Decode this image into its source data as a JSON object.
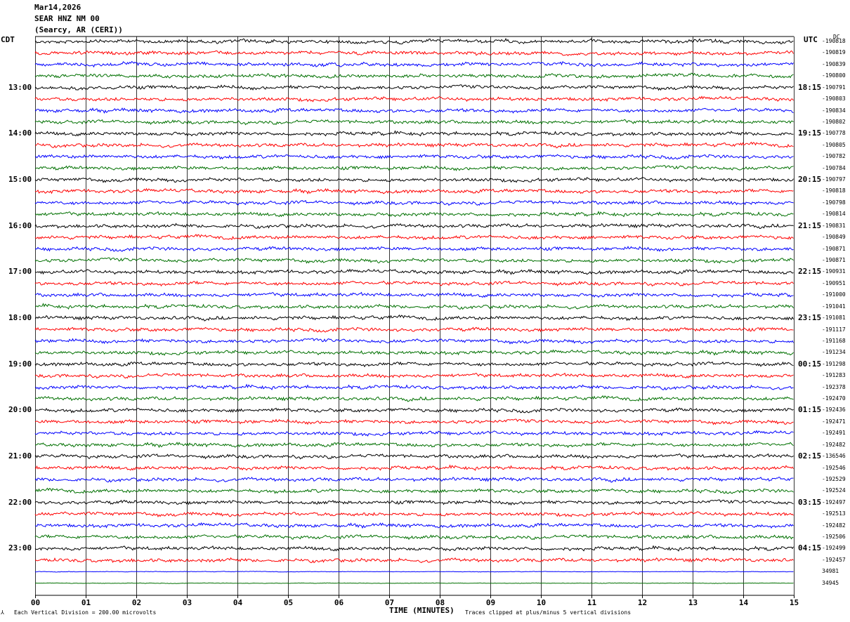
{
  "header": {
    "date": "Mar14,2026",
    "station": "SEAR HNZ NM 00",
    "location": "(Searcy, AR (CERI))"
  },
  "left_tz": "CDT",
  "right_tz": "UTC",
  "top_right_label": "DC",
  "footer": {
    "scale_note": "Each Vertical Division =  200.00 microvolts",
    "clip_note": "Traces clipped at plus/minus 5 vertical divisions",
    "corner_mark": "⅄"
  },
  "colors": {
    "trace_cycle": [
      "#000000",
      "#ff0000",
      "#0000ff",
      "#007000"
    ],
    "grid": "#000000"
  },
  "chart_data": {
    "type": "line",
    "title": "SEAR HNZ NM 00",
    "xlabel": "TIME (MINUTES)",
    "ylabel": "",
    "xlim": [
      0,
      15
    ],
    "x_ticks": [
      "00",
      "01",
      "02",
      "03",
      "04",
      "05",
      "06",
      "07",
      "08",
      "09",
      "10",
      "11",
      "12",
      "13",
      "14",
      "15"
    ],
    "traces_per_hour": 4,
    "minutes_per_trace": 15,
    "left_hour_labels": [
      "13:00",
      "14:00",
      "15:00",
      "16:00",
      "17:00",
      "18:00",
      "19:00",
      "20:00",
      "21:00",
      "22:00",
      "23:00"
    ],
    "right_hour_labels": [
      "18:15",
      "19:15",
      "20:15",
      "21:15",
      "22:15",
      "23:15",
      "00:15",
      "01:15",
      "02:15",
      "03:15",
      "04:15"
    ],
    "trace_offsets": [
      "-190818",
      "-190819",
      "-190839",
      "-190800",
      "-190791",
      "-190803",
      "-190834",
      "-190802",
      "-190778",
      "-190805",
      "-190782",
      "-190784",
      "-190797",
      "-190818",
      "-190798",
      "-190814",
      "-190831",
      "-190849",
      "-190871",
      "-190871",
      "-190931",
      "-190951",
      "-191000",
      "-191041",
      "-191081",
      "-191117",
      "-191168",
      "-191234",
      "-191298",
      "-191283",
      "-192378",
      "-192470",
      "-192436",
      "-192471",
      "-192491",
      "-192482",
      "-136546",
      "-192546",
      "-192529",
      "-192524",
      "-192497",
      "-192513",
      "-192482",
      "-192506",
      "-192499",
      "-192457",
      "34981",
      "34945"
    ]
  }
}
